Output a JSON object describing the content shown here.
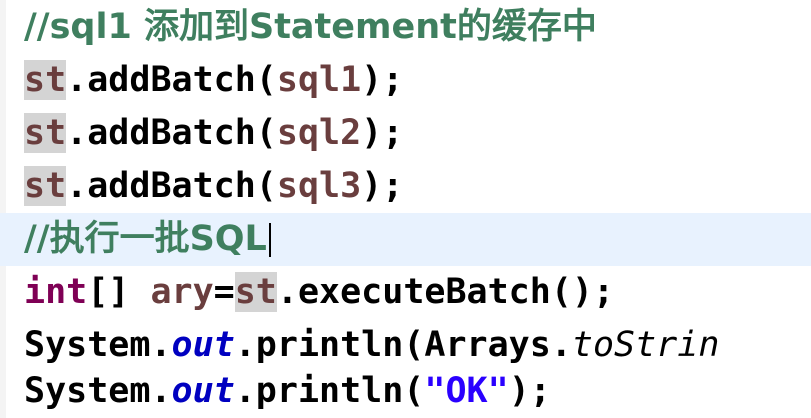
{
  "editor": {
    "lines": [
      {
        "comment": "//sql1 添加到Statement的缓存中"
      },
      {
        "var": "st",
        "call": ".addBatch(",
        "arg": "sql1",
        "end": ");"
      },
      {
        "var": "st",
        "call": ".addBatch(",
        "arg": "sql2",
        "end": ");"
      },
      {
        "var": "st",
        "call": ".addBatch(",
        "arg": "sql3",
        "end": ");"
      },
      {
        "comment": "//执行一批SQL"
      },
      {
        "kw": "int",
        "brackets": "[] ",
        "var": "ary",
        "eq": "=",
        "obj": "st",
        "call": ".executeBatch();"
      },
      {
        "cls": "System.",
        "field": "out",
        "call": ".println(Arrays.",
        "static": "toStrin"
      },
      {
        "cls": "System.",
        "field": "out",
        "call": ".println(",
        "str": "\"OK\"",
        "end": ");"
      }
    ]
  },
  "colors": {
    "comment": "#3f7f5f",
    "keyword": "#7f0055",
    "variable": "#6a3e3e",
    "field": "#0000c0",
    "string": "#2a00ff",
    "current_line": "#e8f2fe",
    "occurrence_highlight": "#d4d4d4"
  }
}
